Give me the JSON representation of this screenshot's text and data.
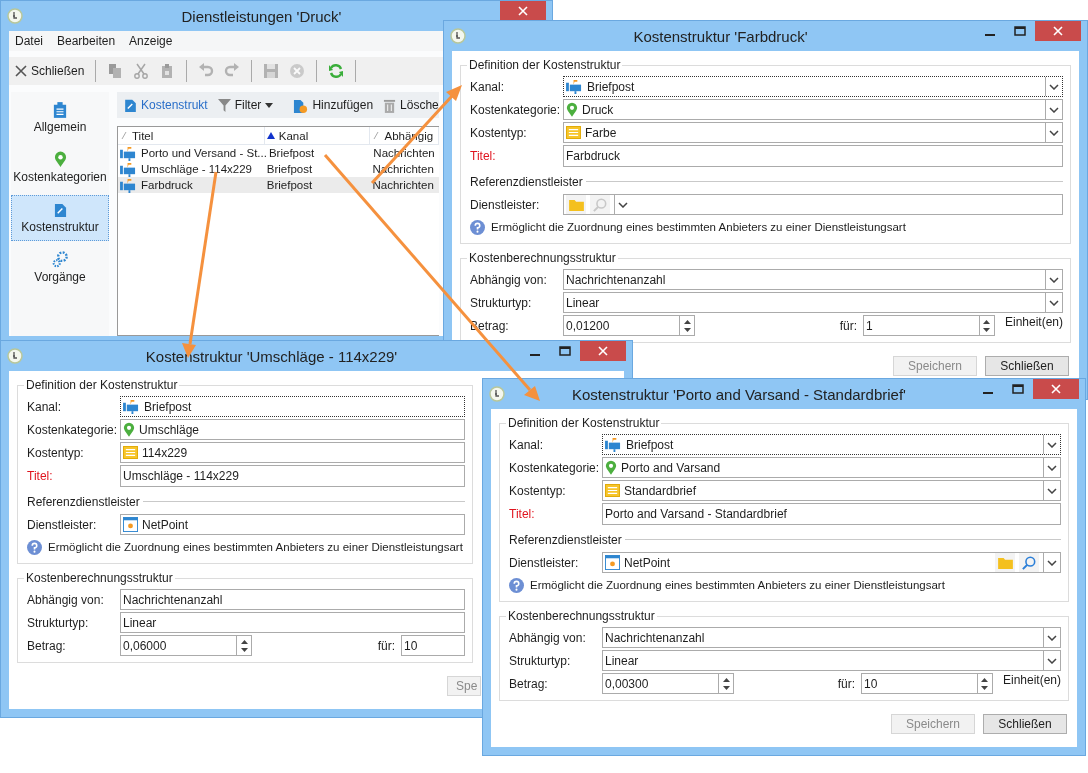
{
  "main_window": {
    "title": "Dienstleistungen 'Druck'",
    "menu": [
      "Datei",
      "Bearbeiten",
      "Anzeige"
    ],
    "toolbar": [
      {
        "kind": "close",
        "label": "Schließen",
        "disabled": false
      },
      {
        "kind": "separator"
      },
      {
        "kind": "copy",
        "disabled": true
      },
      {
        "kind": "cut",
        "disabled": true
      },
      {
        "kind": "paste",
        "disabled": true
      },
      {
        "kind": "separator"
      },
      {
        "kind": "undo",
        "disabled": true
      },
      {
        "kind": "redo",
        "disabled": true
      },
      {
        "kind": "separator"
      },
      {
        "kind": "save",
        "disabled": true
      },
      {
        "kind": "cancel",
        "disabled": true
      },
      {
        "kind": "separator"
      },
      {
        "kind": "refresh",
        "disabled": false
      },
      {
        "kind": "separator"
      }
    ],
    "sidebar": [
      {
        "kind": "general",
        "label": "Allgemein",
        "selected": false
      },
      {
        "kind": "category",
        "label": "Kostenkategorien",
        "selected": false
      },
      {
        "kind": "structure",
        "label": "Kostenstruktur",
        "selected": true
      },
      {
        "kind": "process",
        "label": "Vorgänge",
        "selected": false
      }
    ],
    "list_toolbar": [
      {
        "kind": "edit",
        "label": "Kostenstrukt"
      },
      {
        "kind": "filter",
        "label": "Filter"
      },
      {
        "kind": "add",
        "label": "Hinzufügen"
      },
      {
        "kind": "delete",
        "label": "Lösche"
      }
    ],
    "table": {
      "columns": [
        {
          "label": "Titel",
          "sorted": false
        },
        {
          "label": "Kanal",
          "sorted": true
        },
        {
          "label": "Abhängig",
          "sorted": false
        }
      ],
      "rows": [
        {
          "cells": [
            "Porto und Versand - St...",
            "Briefpost",
            "Nachrichten"
          ],
          "selected": false
        },
        {
          "cells": [
            "Umschläge - 114x229",
            "Briefpost",
            "Nachrichten"
          ],
          "selected": false
        },
        {
          "cells": [
            "Farbdruck",
            "Briefpost",
            "Nachrichten"
          ],
          "selected": true
        }
      ]
    }
  },
  "dialogs": [
    {
      "title": "Kostenstruktur 'Farbdruck'",
      "groups": [
        {
          "title": "Definition der Kostenstruktur",
          "rows": [
            {
              "kind": "channel",
              "label": "Kanal:",
              "value": "Briefpost",
              "required": false,
              "focused": true
            },
            {
              "kind": "category",
              "label": "Kostenkategorie:",
              "value": "Druck",
              "required": false,
              "focused": false
            },
            {
              "kind": "costtype",
              "label": "Kostentyp:",
              "value": "Farbe",
              "required": false,
              "focused": false
            },
            {
              "kind": "text",
              "label": "Titel:",
              "value": "Farbdruck",
              "required": true,
              "focused": false
            },
            {
              "kind": "subheader",
              "label": "Referenzdienstleister"
            },
            {
              "kind": "provider",
              "label": "Dienstleister:",
              "required": false,
              "focused": false,
              "search_enabled": false
            },
            {
              "kind": "help",
              "text": "Ermöglicht die Zuordnung eines bestimmten Anbieters zu einer Dienstleistungsart"
            }
          ]
        },
        {
          "title": "Kostenberechnungsstruktur",
          "rows": [
            {
              "kind": "combo",
              "label": "Abhängig von:",
              "value": "Nachrichtenanzahl",
              "required": false,
              "focused": false
            },
            {
              "kind": "combo",
              "label": "Strukturtyp:",
              "value": "Linear",
              "required": false,
              "focused": false
            },
            {
              "kind": "amount",
              "label": "Betrag:",
              "value": "0,01200",
              "per_label": "für:",
              "per_value": "1",
              "unit": "Einheit(en)",
              "required": false,
              "focused": false
            }
          ]
        }
      ],
      "buttons": [
        {
          "label": "Speichern",
          "disabled": true
        },
        {
          "label": "Schließen",
          "disabled": false
        }
      ]
    },
    {
      "title": "Kostenstruktur 'Umschläge - 114x229'",
      "groups": [
        {
          "title": "Definition der Kostenstruktur",
          "rows": [
            {
              "kind": "channel",
              "label": "Kanal:",
              "value": "Briefpost",
              "required": false,
              "focused": true
            },
            {
              "kind": "category",
              "label": "Kostenkategorie:",
              "value": "Umschläge",
              "required": false,
              "focused": false
            },
            {
              "kind": "costtype",
              "label": "Kostentyp:",
              "value": "114x229",
              "required": false,
              "focused": false
            },
            {
              "kind": "text",
              "label": "Titel:",
              "value": "Umschläge - 114x229",
              "required": true,
              "focused": false
            },
            {
              "kind": "subheader",
              "label": "Referenzdienstleister"
            },
            {
              "kind": "provider",
              "label": "Dienstleister:",
              "value": "NetPoint",
              "required": false,
              "focused": false
            },
            {
              "kind": "help",
              "text": "Ermöglicht die Zuordnung eines bestimmten Anbieters zu einer Dienstleistungsart"
            }
          ]
        },
        {
          "title": "Kostenberechnungsstruktur",
          "rows": [
            {
              "kind": "combo",
              "label": "Abhängig von:",
              "value": "Nachrichtenanzahl",
              "required": false,
              "focused": false
            },
            {
              "kind": "combo",
              "label": "Strukturtyp:",
              "value": "Linear",
              "required": false,
              "focused": false
            },
            {
              "kind": "amount",
              "label": "Betrag:",
              "value": "0,06000",
              "per_label": "für:",
              "per_value": "10",
              "required": false,
              "focused": false
            }
          ]
        }
      ],
      "buttons": [
        {
          "label": "Spe",
          "disabled": true
        }
      ]
    },
    {
      "title": "Kostenstruktur 'Porto and Varsand - Standardbrief'",
      "groups": [
        {
          "title": "Definition der Kostenstruktur",
          "rows": [
            {
              "kind": "channel",
              "label": "Kanal:",
              "value": "Briefpost",
              "required": false,
              "focused": true
            },
            {
              "kind": "category",
              "label": "Kostenkategorie:",
              "value": "Porto and Varsand",
              "required": false,
              "focused": false
            },
            {
              "kind": "costtype",
              "label": "Kostentyp:",
              "value": "Standardbrief",
              "required": false,
              "focused": false
            },
            {
              "kind": "text",
              "label": "Titel:",
              "value": "Porto and Varsand - Standardbrief",
              "required": true,
              "focused": false
            },
            {
              "kind": "subheader",
              "label": "Referenzdienstleister"
            },
            {
              "kind": "provider",
              "label": "Dienstleister:",
              "value": "NetPoint",
              "required": false,
              "focused": false,
              "search_enabled": true
            },
            {
              "kind": "help",
              "text": "Ermöglicht die Zuordnung eines bestimmten Anbieters zu einer Dienstleistungsart"
            }
          ]
        },
        {
          "title": "Kostenberechnungsstruktur",
          "rows": [
            {
              "kind": "combo",
              "label": "Abhängig von:",
              "value": "Nachrichtenanzahl",
              "required": false,
              "focused": false
            },
            {
              "kind": "combo",
              "label": "Strukturtyp:",
              "value": "Linear",
              "required": false,
              "focused": false
            },
            {
              "kind": "amount",
              "label": "Betrag:",
              "value": "0,00300",
              "per_label": "für:",
              "per_value": "10",
              "unit": "Einheit(en)",
              "required": false,
              "focused": false
            }
          ]
        }
      ],
      "buttons": [
        {
          "label": "Speichern",
          "disabled": true
        },
        {
          "label": "Schließen",
          "disabled": false
        }
      ]
    }
  ]
}
